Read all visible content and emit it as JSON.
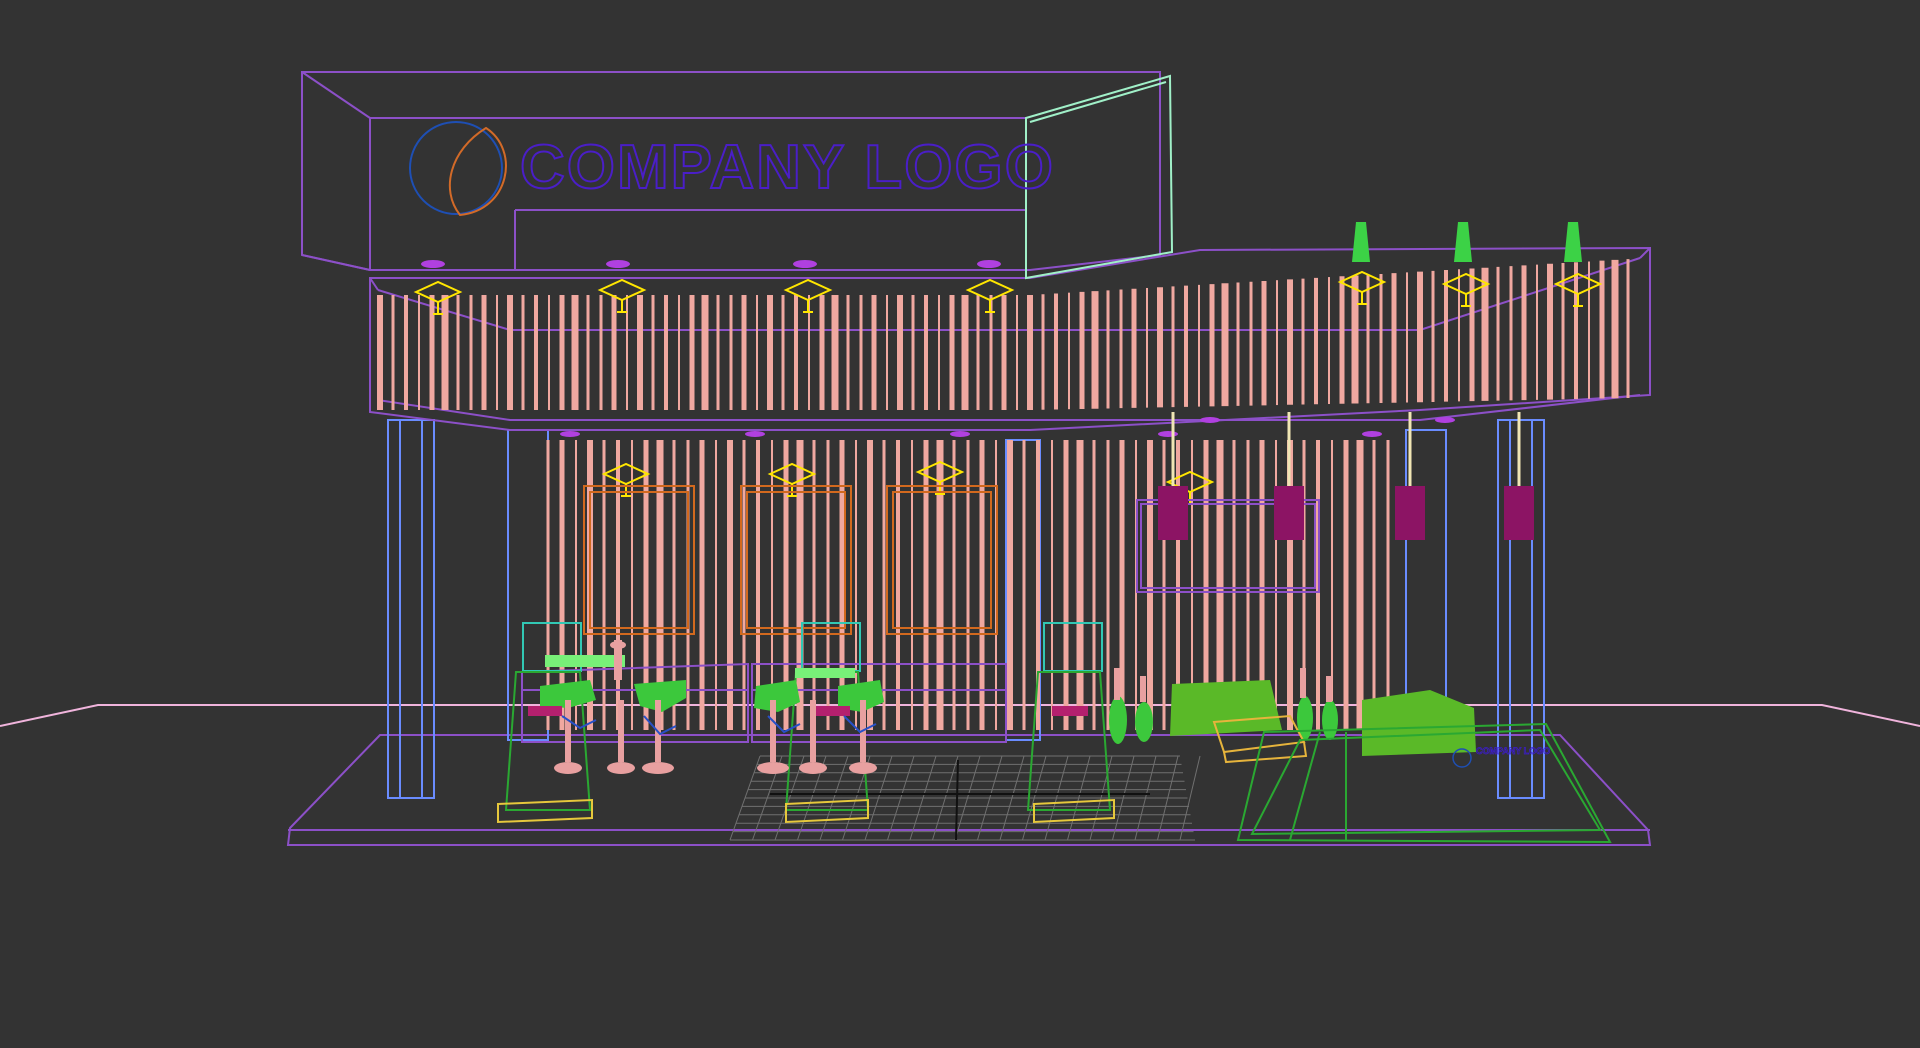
{
  "viewport": {
    "background": "#333333",
    "render_mode": "wireframe"
  },
  "sign": {
    "logo_text": "COMPANY LOGO",
    "logo_icon": "crescent-emblem-icon"
  },
  "counter_badge": {
    "text": "COMPANY LOGO"
  },
  "colors": {
    "pink_slats": "#f0a8a0",
    "purple_frame": "#8c50c8",
    "blue_columns": "#6a8cff",
    "yellow_lights": "#ffe600",
    "green_furniture": "#50c832",
    "magenta_pendants": "#8c1464",
    "orange_frames": "#d2691e",
    "teal_monitors": "#32c8b4",
    "grid_floor": "#707070",
    "ground_line": "#f0b4dc"
  }
}
